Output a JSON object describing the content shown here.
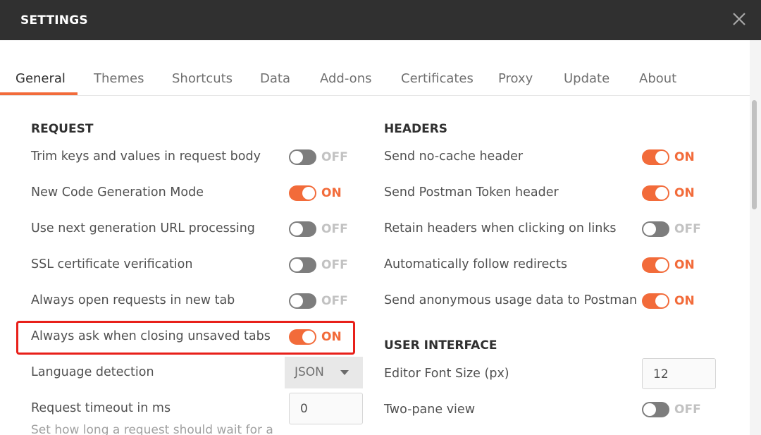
{
  "window": {
    "title": "SETTINGS"
  },
  "tabs": [
    {
      "label": "General",
      "active": true
    },
    {
      "label": "Themes"
    },
    {
      "label": "Shortcuts"
    },
    {
      "label": "Data"
    },
    {
      "label": "Add-ons"
    },
    {
      "label": "Certificates"
    },
    {
      "label": "Proxy"
    },
    {
      "label": "Update"
    },
    {
      "label": "About"
    }
  ],
  "request": {
    "title": "REQUEST",
    "trim_keys": {
      "label": "Trim keys and values in request body",
      "state": "OFF"
    },
    "code_gen": {
      "label": "New Code Generation Mode",
      "state": "ON"
    },
    "next_url": {
      "label": "Use next generation URL processing",
      "state": "OFF"
    },
    "ssl": {
      "label": "SSL certificate verification",
      "state": "OFF"
    },
    "new_tab": {
      "label": "Always open requests in new tab",
      "state": "OFF"
    },
    "ask_closing": {
      "label": "Always ask when closing unsaved tabs",
      "state": "ON"
    },
    "language": {
      "label": "Language detection",
      "value": "JSON"
    },
    "timeout": {
      "label": "Request timeout in ms",
      "value": "0",
      "helper": "Set how long a request should wait for a"
    }
  },
  "headers": {
    "title": "HEADERS",
    "no_cache": {
      "label": "Send no-cache header",
      "state": "ON"
    },
    "postman_token": {
      "label": "Send Postman Token header",
      "state": "ON"
    },
    "retain": {
      "label": "Retain headers when clicking on links",
      "state": "OFF"
    },
    "redirects": {
      "label": "Automatically follow redirects",
      "state": "ON"
    },
    "usage": {
      "label": "Send anonymous usage data to Postman",
      "state": "ON"
    }
  },
  "ui": {
    "title": "USER INTERFACE",
    "font_size": {
      "label": "Editor Font Size (px)",
      "value": "12"
    },
    "two_pane": {
      "label": "Two-pane view",
      "state": "OFF"
    }
  },
  "colors": {
    "accent": "#f26b3a",
    "toggle_off": "#7d7d7d",
    "titlebar": "#303030",
    "highlight": "#e8201a"
  },
  "icons": {
    "close": "close-icon",
    "dropdown": "chevron-down-icon"
  }
}
